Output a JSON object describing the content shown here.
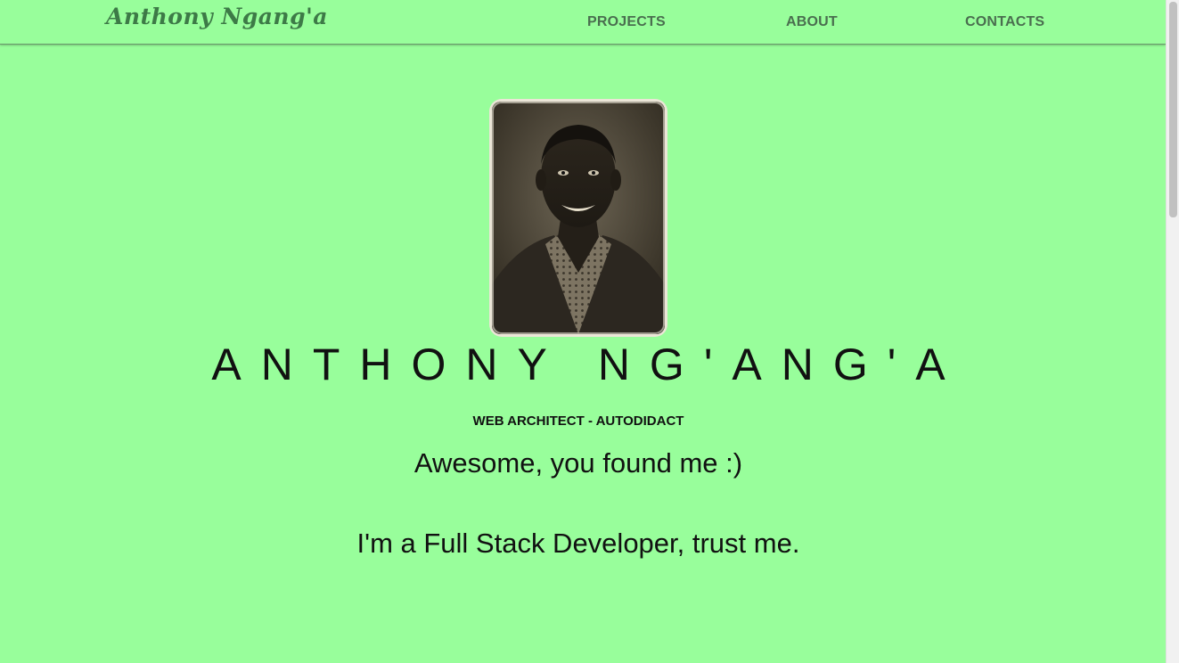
{
  "header": {
    "brand": "Anthony Ngang'a",
    "nav": {
      "projects": "PROJECTS",
      "about": "ABOUT",
      "contacts": "CONTACTS"
    }
  },
  "hero": {
    "name": "ANTHONY NG'ANG'A",
    "role": "WEB ARCHITECT - AUTODIDACT",
    "line1": "Awesome, you found me :)",
    "line2": "I'm a Full Stack Developer, trust me."
  },
  "colors": {
    "background": "#98fe9b",
    "brand": "#3d7a47",
    "nav_text": "#4a6e4f",
    "text": "#111111"
  }
}
